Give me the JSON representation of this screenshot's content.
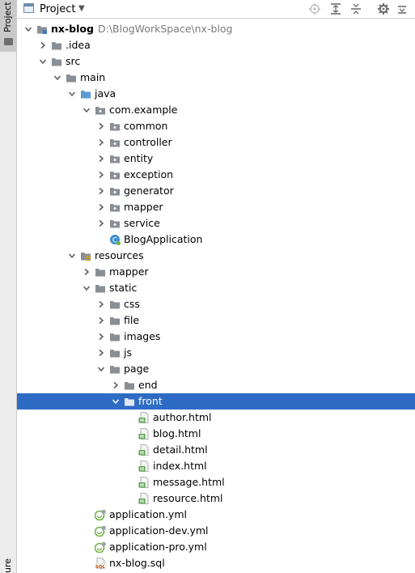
{
  "sidebar": {
    "tab_label": "Project",
    "bottom_label": "ure"
  },
  "header": {
    "title": "Project"
  },
  "colors": {
    "selection": "#2e6bc4",
    "folder": "#8a8f95",
    "html_badge": "#57a64a",
    "spring": "#6db33f",
    "java_class": "#3d8fd1"
  },
  "tree": [
    {
      "label": "nx-blog",
      "path": "D:\\BlogWorkSpace\\nx-blog",
      "depth": 0,
      "expanded": true,
      "icon": "module-folder-icon",
      "bold": true
    },
    {
      "label": ".idea",
      "depth": 1,
      "expanded": false,
      "icon": "folder-icon"
    },
    {
      "label": "src",
      "depth": 1,
      "expanded": true,
      "icon": "folder-icon"
    },
    {
      "label": "main",
      "depth": 2,
      "expanded": true,
      "icon": "folder-icon"
    },
    {
      "label": "java",
      "depth": 3,
      "expanded": true,
      "icon": "source-folder-icon"
    },
    {
      "label": "com.example",
      "depth": 4,
      "expanded": true,
      "icon": "package-icon"
    },
    {
      "label": "common",
      "depth": 5,
      "expanded": false,
      "icon": "package-icon"
    },
    {
      "label": "controller",
      "depth": 5,
      "expanded": false,
      "icon": "package-icon"
    },
    {
      "label": "entity",
      "depth": 5,
      "expanded": false,
      "icon": "package-icon"
    },
    {
      "label": "exception",
      "depth": 5,
      "expanded": false,
      "icon": "package-icon"
    },
    {
      "label": "generator",
      "depth": 5,
      "expanded": false,
      "icon": "package-icon"
    },
    {
      "label": "mapper",
      "depth": 5,
      "expanded": false,
      "icon": "package-icon"
    },
    {
      "label": "service",
      "depth": 5,
      "expanded": false,
      "icon": "package-icon"
    },
    {
      "label": "BlogApplication",
      "depth": 5,
      "icon": "spring-class-icon"
    },
    {
      "label": "resources",
      "depth": 3,
      "expanded": true,
      "icon": "resources-folder-icon"
    },
    {
      "label": "mapper",
      "depth": 4,
      "expanded": false,
      "icon": "folder-icon"
    },
    {
      "label": "static",
      "depth": 4,
      "expanded": true,
      "icon": "folder-icon"
    },
    {
      "label": "css",
      "depth": 5,
      "expanded": false,
      "icon": "folder-icon"
    },
    {
      "label": "file",
      "depth": 5,
      "expanded": false,
      "icon": "folder-icon"
    },
    {
      "label": "images",
      "depth": 5,
      "expanded": false,
      "icon": "folder-icon"
    },
    {
      "label": "js",
      "depth": 5,
      "expanded": false,
      "icon": "folder-icon"
    },
    {
      "label": "page",
      "depth": 5,
      "expanded": true,
      "icon": "folder-icon"
    },
    {
      "label": "end",
      "depth": 6,
      "expanded": false,
      "icon": "folder-icon"
    },
    {
      "label": "front",
      "depth": 6,
      "expanded": true,
      "icon": "folder-icon",
      "selected": true
    },
    {
      "label": "author.html",
      "depth": 7,
      "icon": "html-file-icon"
    },
    {
      "label": "blog.html",
      "depth": 7,
      "icon": "html-file-icon"
    },
    {
      "label": "detail.html",
      "depth": 7,
      "icon": "html-file-icon"
    },
    {
      "label": "index.html",
      "depth": 7,
      "icon": "html-file-icon"
    },
    {
      "label": "message.html",
      "depth": 7,
      "icon": "html-file-icon"
    },
    {
      "label": "resource.html",
      "depth": 7,
      "icon": "html-file-icon"
    },
    {
      "label": "application.yml",
      "depth": 4,
      "icon": "spring-yml-icon"
    },
    {
      "label": "application-dev.yml",
      "depth": 4,
      "icon": "spring-yml-icon"
    },
    {
      "label": "application-pro.yml",
      "depth": 4,
      "icon": "spring-yml-icon"
    },
    {
      "label": "nx-blog.sql",
      "depth": 4,
      "icon": "sql-file-icon"
    }
  ]
}
